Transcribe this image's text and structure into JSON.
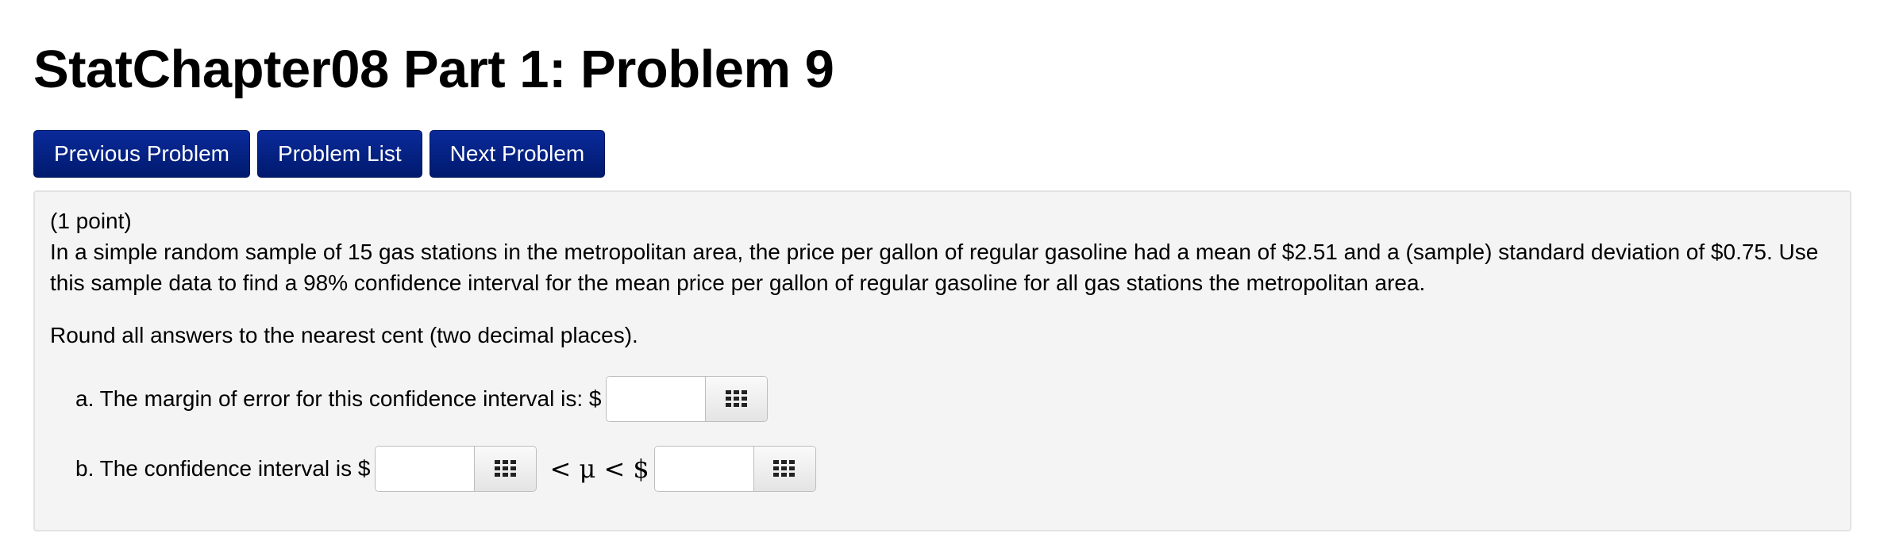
{
  "page": {
    "title": "StatChapter08 Part 1: Problem 9"
  },
  "nav": {
    "previous_label": "Previous Problem",
    "list_label": "Problem List",
    "next_label": "Next Problem"
  },
  "problem": {
    "points": "(1 point)",
    "body": "In a simple random sample of 15 gas stations in the metropolitan area, the price per gallon of regular gasoline had a mean of $2.51 and a (sample) standard deviation of $0.75. Use this sample data to find a 98% confidence interval for the mean price per gallon of regular gasoline for all gas stations the metropolitan area.",
    "rounding_note": "Round all answers to the nearest cent (two decimal places).",
    "part_a": {
      "label": "a. The margin of error for this confidence interval is: $",
      "value": ""
    },
    "part_b": {
      "label": "b. The confidence interval is $",
      "lower_value": "",
      "middle": "< μ < $",
      "upper_value": ""
    }
  },
  "icons": {
    "answer_helper": "grid-icon"
  }
}
